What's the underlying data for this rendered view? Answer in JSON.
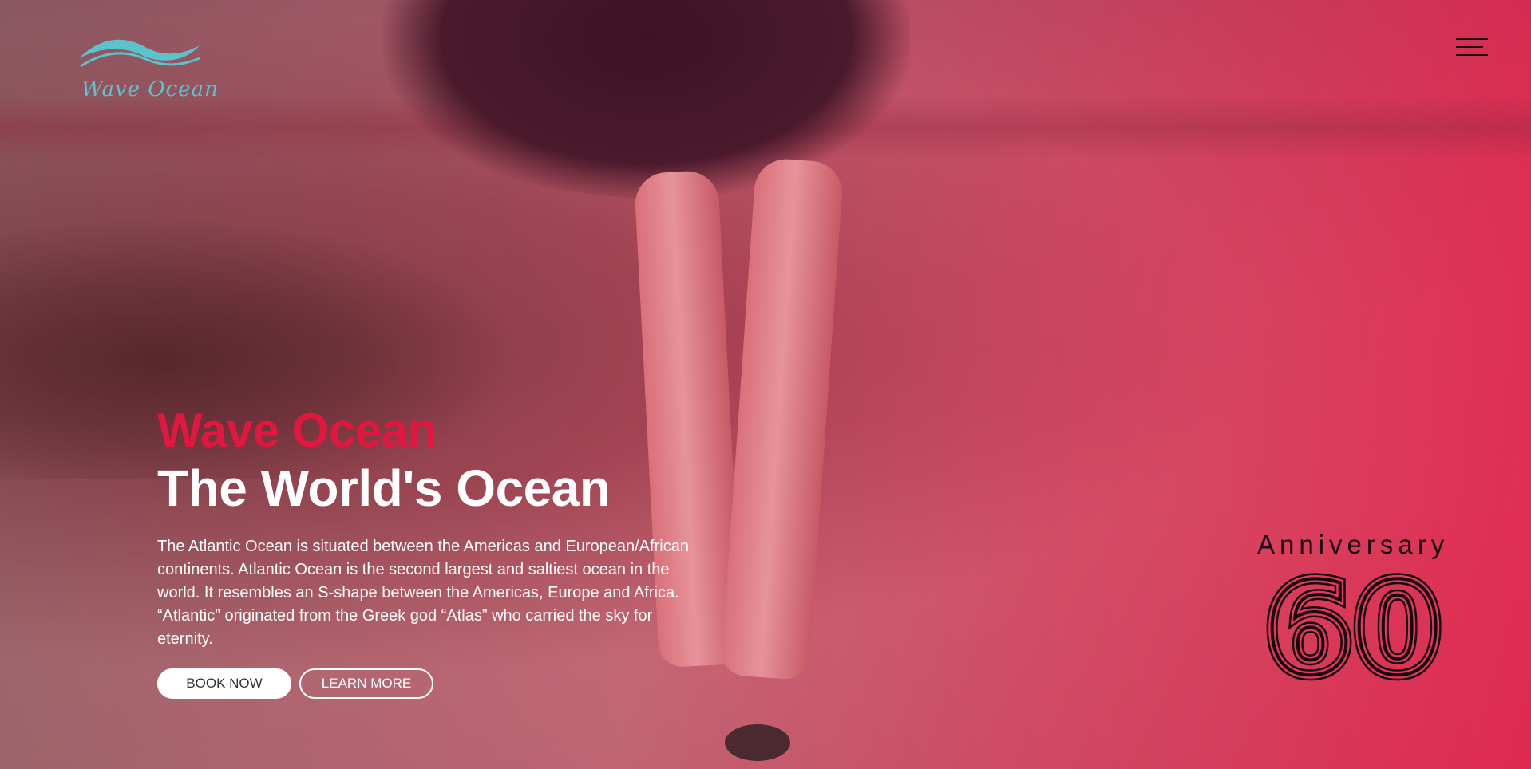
{
  "brand": {
    "logo_text": "Wave Ocean",
    "logo_color": "#5ac3cc"
  },
  "nav": {
    "menu_icon": "hamburger-menu-icon"
  },
  "hero": {
    "eyebrow": "Wave Ocean",
    "headline": "The World's Ocean",
    "description": "The Atlantic Ocean is situated between the Americas and European/African continents. Atlantic Ocean is the second largest and saltiest ocean in the world. It resembles an S-shape between the Americas, Europe and Africa. “Atlantic” originated from the Greek god “Atlas” who carried the sky for eternity.",
    "primary_button": "BOOK NOW",
    "secondary_button": "LEARN MORE",
    "accent_color": "#e0173f"
  },
  "anniversary": {
    "label": "Anniversary",
    "number": "60"
  }
}
